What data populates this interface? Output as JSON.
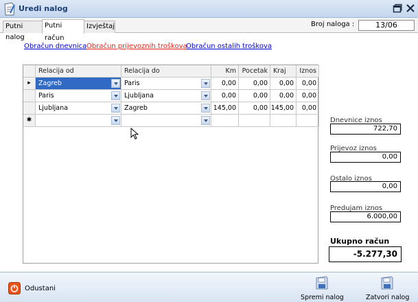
{
  "window": {
    "title": "Uredi nalog"
  },
  "tabs": [
    {
      "label": "Putni nalog",
      "active": false
    },
    {
      "label": "Putni račun",
      "active": true
    },
    {
      "label": "Izvještaj",
      "active": false
    }
  ],
  "header": {
    "broj_label": "Broj naloga :",
    "broj_value": "13/06"
  },
  "links": {
    "dnevnica": "Obračun dnevnica",
    "prijevoz": "Obračun prijevoznih troškova",
    "ostali": "Obračun ostalih troškova"
  },
  "grid": {
    "columns": [
      "Relacija od",
      "Relacija do",
      "Km",
      "Pocetak",
      "Kraj",
      "Iznos"
    ],
    "rows": [
      {
        "indicator": "▸",
        "od": "Zagreb",
        "do": "Paris",
        "km": "0,00",
        "pocetak": "0,00",
        "kraj": "0,00",
        "iznos": "0,00"
      },
      {
        "indicator": "",
        "od": "Paris",
        "do": "Ljubljana",
        "km": "0,00",
        "pocetak": "0,00",
        "kraj": "0,00",
        "iznos": "0,00"
      },
      {
        "indicator": "",
        "od": "Ljubljana",
        "do": "Zagreb",
        "km": "145,00",
        "pocetak": "0,00",
        "kraj": "145,00",
        "iznos": "0,00"
      }
    ],
    "new_row_indicator": "✱"
  },
  "summary": {
    "dnevnice_label": "Dnevnice iznos",
    "dnevnice_value": "722,70",
    "prijevoz_label": "Prijevoz iznos",
    "prijevoz_value": "0,00",
    "ostalo_label": "Ostalo iznos",
    "ostalo_value": "0,00",
    "predujam_label": "Predujam iznos",
    "predujam_value": "6.000,00",
    "ukupno_label": "Ukupno račun",
    "ukupno_value": "-5.277,30"
  },
  "footer": {
    "cancel_label": "Odustani",
    "save_label": "Spremi nalog",
    "close_label": "Zatvori nalog"
  },
  "colors": {
    "accent": "#316ac5",
    "link_blue": "#0000cc",
    "link_red": "#e0241b",
    "cancel_icon": "#e8541a"
  }
}
